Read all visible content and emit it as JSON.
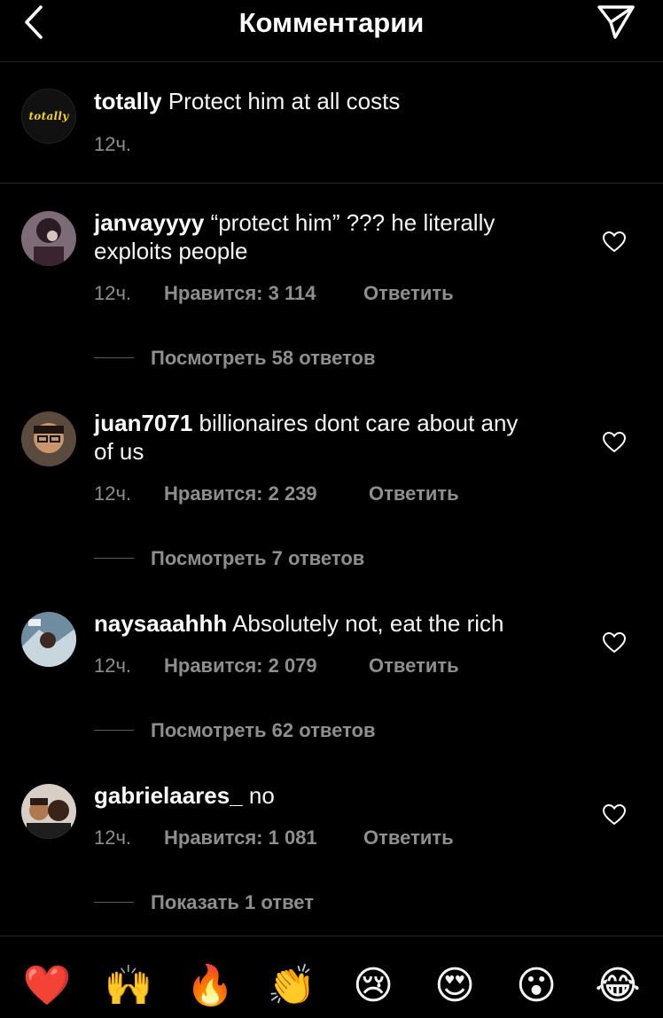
{
  "header": {
    "title": "Комментарии"
  },
  "caption": {
    "username": "totally",
    "text": "Protect him at all costs",
    "time": "12ч.",
    "logo_text": "totally"
  },
  "comments": [
    {
      "username": "janvayyyy",
      "text_line1": "“protect him” ??? he literally",
      "text_line2": "exploits people",
      "time": "12ч.",
      "likes": "Нравится: 3 114",
      "reply": "Ответить",
      "replies": "Посмотреть 58 ответов"
    },
    {
      "username": "juan7071",
      "text_line1": "billionaires dont care about any",
      "text_line2": "of us",
      "time": "12ч.",
      "likes": "Нравится: 2 239",
      "reply": "Ответить",
      "replies": "Посмотреть 7 ответов"
    },
    {
      "username": "naysaaahhh",
      "text_line1": "Absolutely not, eat the rich",
      "time": "12ч.",
      "likes": "Нравится: 2 079",
      "reply": "Ответить",
      "replies": "Посмотреть 62 ответов"
    },
    {
      "username": "gabrielaares_",
      "text_line1": "no",
      "time": "12ч.",
      "likes": "Нравится: 1 081",
      "reply": "Ответить",
      "replies": "Показать 1 ответ"
    }
  ],
  "emoji_bar": [
    "❤️",
    "🙌",
    "🔥",
    "👏",
    "😢",
    "😍",
    "😮",
    "😂"
  ],
  "colors": {
    "background": "#000000",
    "text": "#f5f5f5",
    "secondary": "#8e8e8e",
    "divider": "#262626",
    "logo": "#f5d21c"
  }
}
